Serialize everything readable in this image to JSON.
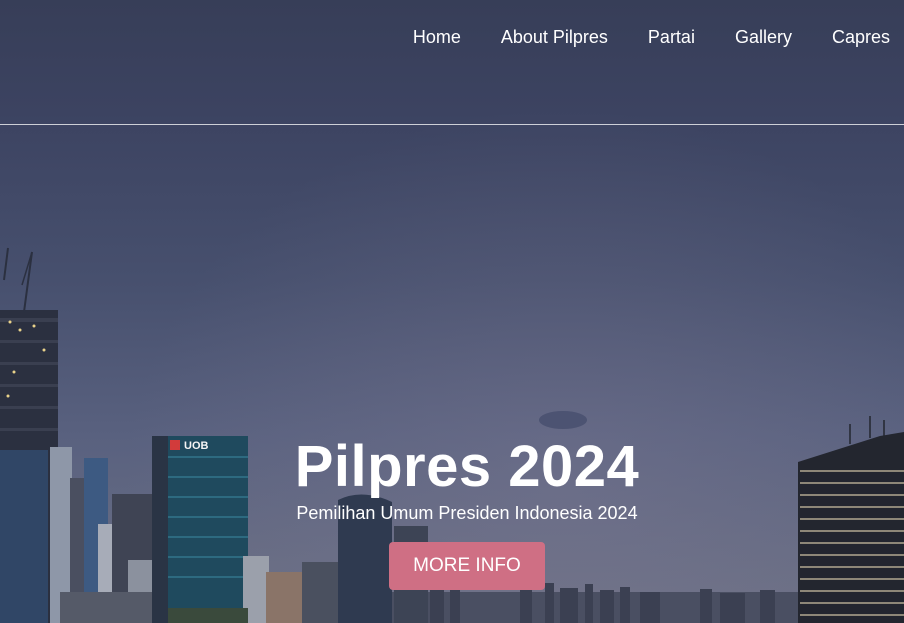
{
  "nav": {
    "items": [
      {
        "label": "Home"
      },
      {
        "label": "About Pilpres"
      },
      {
        "label": "Partai"
      },
      {
        "label": "Gallery"
      },
      {
        "label": "Capres"
      }
    ]
  },
  "hero": {
    "title": "Pilpres 2024",
    "subtitle": "Pemilihan Umum Presiden Indonesia 2024",
    "button_label": "MORE INFO",
    "button_color": "#cf6f84",
    "sign_text": "UOB"
  },
  "colors": {
    "sky_top": "#373e58",
    "sky_bottom": "#6d7185"
  }
}
